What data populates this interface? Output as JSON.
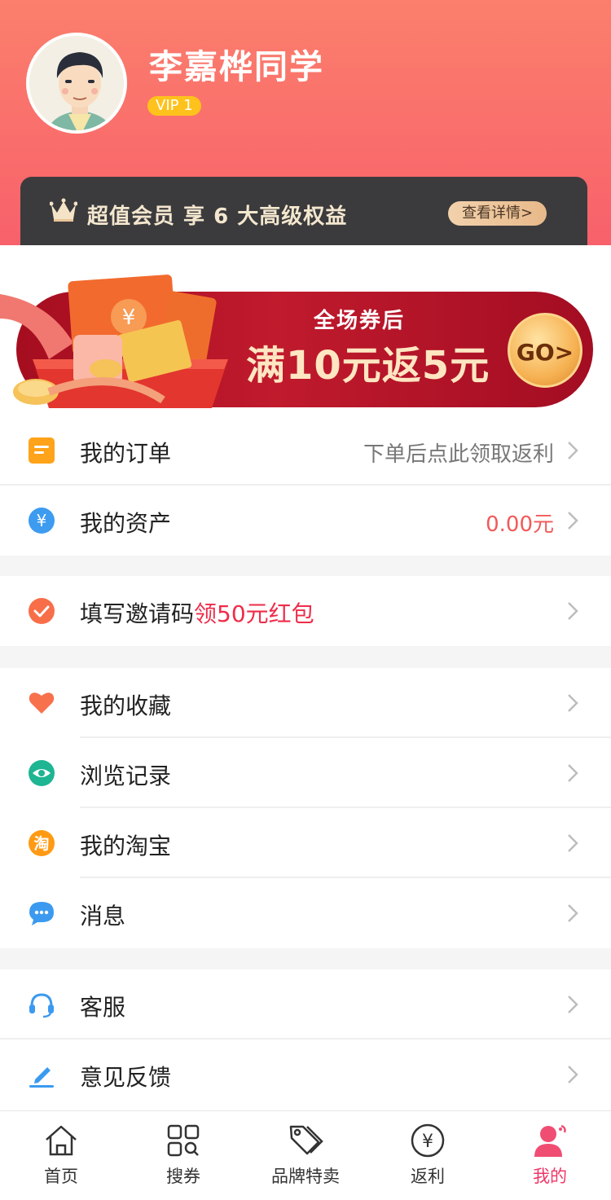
{
  "header": {
    "user_name": "李嘉桦同学",
    "vip_level": "VIP 1",
    "vip_card_text": "超值会员  享 6 大高级权益",
    "vip_detail_button": "查看详情>"
  },
  "banner": {
    "line1": "全场券后",
    "line2": "满10元返5元",
    "go_label": "GO>"
  },
  "menu": {
    "orders": {
      "label": "我的订单",
      "hint": "下单后点此领取返利"
    },
    "assets": {
      "label": "我的资产",
      "hint": "0.00元"
    },
    "invite": {
      "label": "填写邀请码",
      "highlight": "领50元红包"
    },
    "favorites": {
      "label": "我的收藏"
    },
    "history": {
      "label": "浏览记录"
    },
    "taobao": {
      "label": "我的淘宝"
    },
    "messages": {
      "label": "消息"
    },
    "service": {
      "label": "客服"
    },
    "feedback": {
      "label": "意见反馈"
    }
  },
  "icons": {
    "taobao_glyph": "淘",
    "yen_glyph": "¥"
  },
  "tabbar": {
    "items": [
      {
        "label": "首页",
        "icon": "home-icon"
      },
      {
        "label": "搜券",
        "icon": "search-coupon-icon"
      },
      {
        "label": "品牌特卖",
        "icon": "tag-icon"
      },
      {
        "label": "返利",
        "icon": "yen-circle-icon"
      },
      {
        "label": "我的",
        "icon": "profile-icon",
        "active": true
      }
    ]
  },
  "colors": {
    "header_gradient_top": "#fb7f6c",
    "header_gradient_bottom": "#f8616b",
    "accent_red": "#ee2d4a",
    "active_tab": "#ee3766"
  }
}
